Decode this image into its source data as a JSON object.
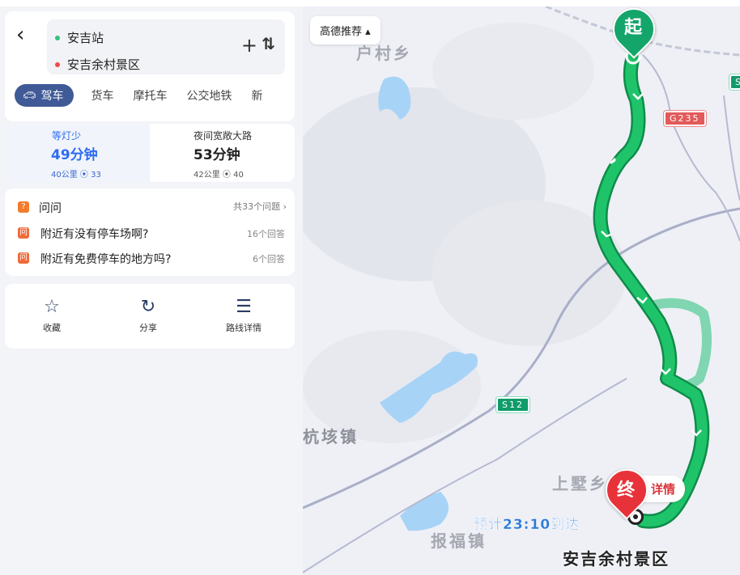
{
  "header": {
    "back_icon": "chevron-left-icon",
    "start": "安吉站",
    "end": "安吉余村景区",
    "start_color": "#2ec27e",
    "end_color": "#ef4a4a",
    "add_icon": "plus-icon",
    "swap_icon": "swap-icon"
  },
  "modes": [
    {
      "label": "驾车",
      "icon": "car-icon",
      "active": true
    },
    {
      "label": "货车"
    },
    {
      "label": "摩托车"
    },
    {
      "label": "公交地铁"
    },
    {
      "label": "新"
    }
  ],
  "routes": [
    {
      "name": "等灯少",
      "time": "49分钟",
      "distance": "40公里",
      "lights": "33",
      "selected": true
    },
    {
      "name": "夜间宽敞大路",
      "time": "53分钟",
      "distance": "42公里",
      "lights": "40",
      "selected": false
    }
  ],
  "qa": {
    "title": "问问",
    "total": "共33个问题",
    "icon": "question-bubble-icon",
    "badge": "问",
    "items": [
      {
        "question": "附近有没有停车场啊?",
        "answers": "16个回答"
      },
      {
        "question": "附近有免费停车的地方吗?",
        "answers": "6个回答"
      }
    ]
  },
  "actions": [
    {
      "label": "收藏",
      "icon": "star-icon"
    },
    {
      "label": "分享",
      "icon": "share-icon"
    },
    {
      "label": "路线详情",
      "icon": "list-icon"
    }
  ],
  "map": {
    "recommend": "高德推荐",
    "start_pin": "起",
    "end_pin": "终",
    "detail": "详情",
    "eta": "预计23:10到达",
    "destination": "安吉余村景区",
    "place_labels": [
      "户村乡",
      "杭垓镇",
      "上墅乡",
      "报福镇"
    ],
    "highways": [
      "G235",
      "S12",
      "S"
    ],
    "route_color": "#1fc46a",
    "alt_route_color": "#7fd6b0"
  }
}
